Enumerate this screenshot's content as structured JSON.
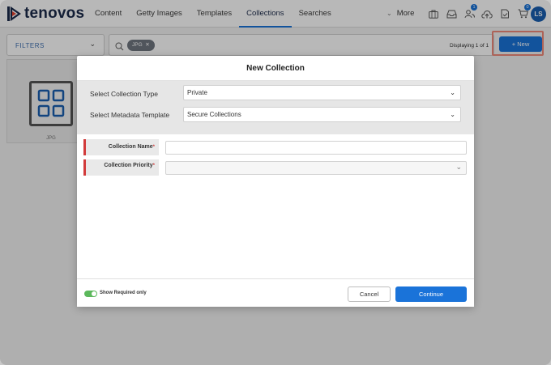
{
  "header": {
    "logo_text": "tenovos",
    "nav": [
      "Content",
      "Getty Images",
      "Templates",
      "Collections",
      "Searches"
    ],
    "active_nav": "Collections",
    "more_label": "More",
    "icons": [
      {
        "name": "briefcase-icon"
      },
      {
        "name": "inbox-icon"
      },
      {
        "name": "users-icon",
        "badge": "1"
      },
      {
        "name": "upload-cloud-icon"
      },
      {
        "name": "document-check-icon"
      },
      {
        "name": "cart-icon",
        "badge": "0"
      }
    ],
    "avatar_initials": "LS"
  },
  "toolbar": {
    "filters_label": "FILTERS",
    "search_chip": "JPG",
    "displaying_text": "Displaying 1 of 1",
    "new_button_label": "+ New"
  },
  "background_card": {
    "label": "JPG",
    "icon": "grid-icon"
  },
  "modal": {
    "title": "New Collection",
    "collection_type_label": "Select Collection Type",
    "collection_type_value": "Private",
    "metadata_template_label": "Select Metadata Template",
    "metadata_template_value": "Secure Collections",
    "fields": [
      {
        "label": "Collection Name",
        "required_mark": "*",
        "type": "text",
        "value": ""
      },
      {
        "label": "Collection Priority",
        "required_mark": "*",
        "type": "select",
        "value": ""
      }
    ],
    "show_required_label": "Show Required only",
    "show_required_enabled": true,
    "cancel_label": "Cancel",
    "continue_label": "Continue"
  },
  "colors": {
    "accent": "#1a73d9",
    "required": "#d23b3b",
    "toggle_on": "#5cb85c",
    "highlight_outline": "#f08a7a"
  }
}
